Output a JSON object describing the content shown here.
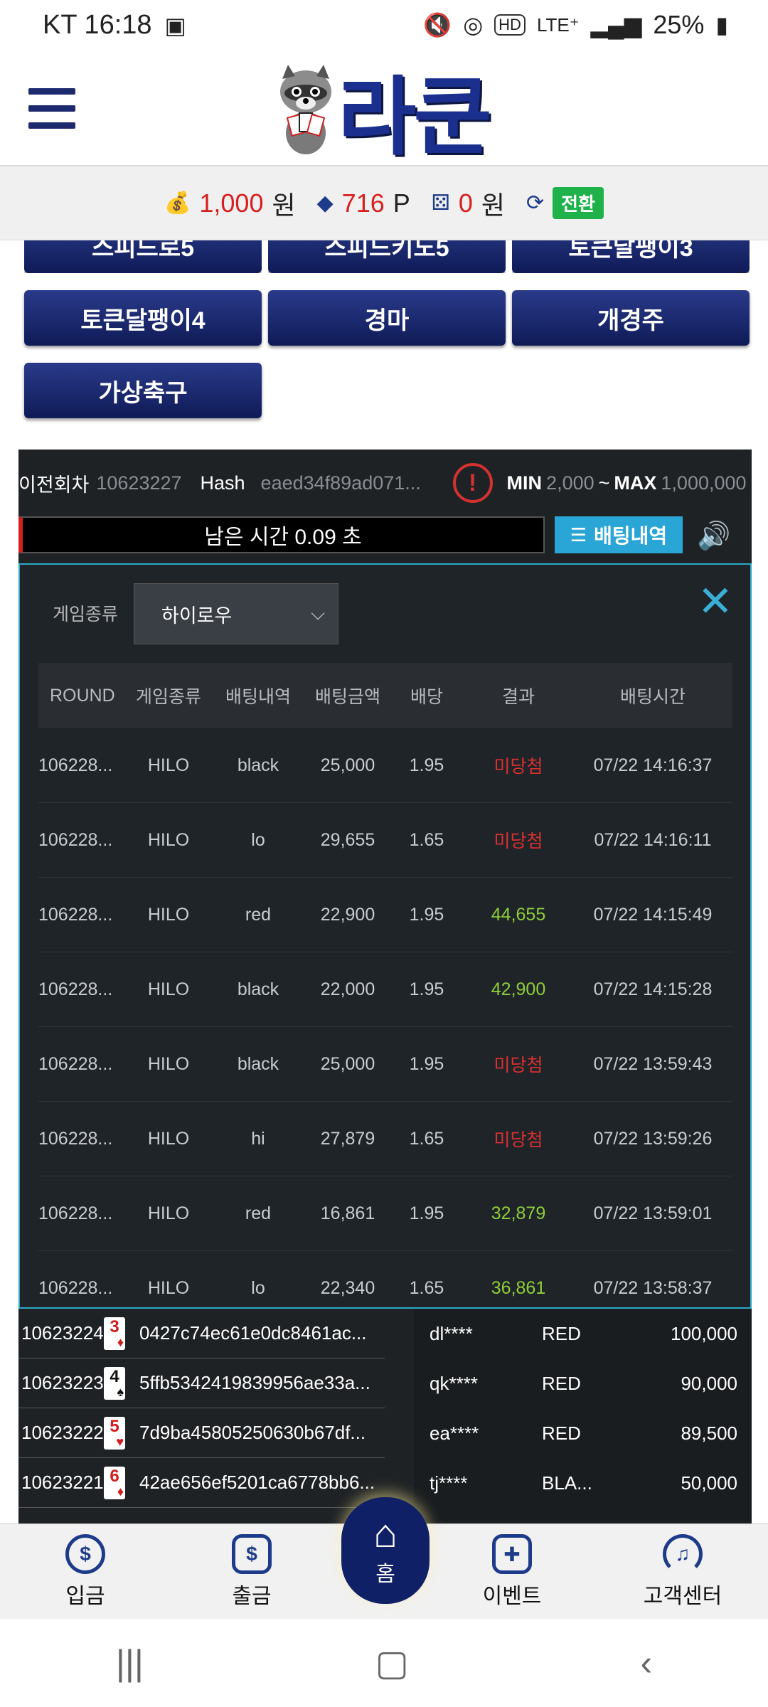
{
  "status_bar": {
    "carrier_time": "KT 16:18",
    "network": "LTE⁺",
    "battery": "25%"
  },
  "header": {
    "logo_text": "라쿤"
  },
  "balance": {
    "cash_value": "1,000",
    "cash_unit": "원",
    "points_value": "716",
    "points_unit": "P",
    "chips_value": "0",
    "chips_unit": "원",
    "swap_label": "전환"
  },
  "games": {
    "row0": [
      "스피드로5",
      "스피드키노5",
      "토큰달팽이3"
    ],
    "row1": [
      "토큰달팽이4",
      "경마",
      "개경주"
    ],
    "row2": [
      "가상축구"
    ]
  },
  "game_info": {
    "prev_round_label": "이전회차",
    "prev_round_value": "10623227",
    "hash_label": "Hash",
    "hash_value": "eaed34f89ad071...",
    "min_label": "MIN",
    "min_value": "2,000",
    "tilde": "~",
    "max_label": "MAX",
    "max_value": "1,000,000",
    "timer_text": "남은 시간 0.09 초",
    "history_button": "배팅내역"
  },
  "history_modal": {
    "filter_label": "게임종류",
    "filter_value": "하이로우",
    "columns": [
      "ROUND",
      "게임종류",
      "배팅내역",
      "배팅금액",
      "배당",
      "결과",
      "배팅시간"
    ],
    "rows": [
      {
        "round": "106228...",
        "game": "HILO",
        "bet": "black",
        "amount": "25,000",
        "odds": "1.95",
        "result": "미당첨",
        "time": "07/22 14:16:37"
      },
      {
        "round": "106228...",
        "game": "HILO",
        "bet": "lo",
        "amount": "29,655",
        "odds": "1.65",
        "result": "미당첨",
        "time": "07/22 14:16:11"
      },
      {
        "round": "106228...",
        "game": "HILO",
        "bet": "red",
        "amount": "22,900",
        "odds": "1.95",
        "result": "44,655",
        "time": "07/22 14:15:49"
      },
      {
        "round": "106228...",
        "game": "HILO",
        "bet": "black",
        "amount": "22,000",
        "odds": "1.95",
        "result": "42,900",
        "time": "07/22 14:15:28"
      },
      {
        "round": "106228...",
        "game": "HILO",
        "bet": "black",
        "amount": "25,000",
        "odds": "1.95",
        "result": "미당첨",
        "time": "07/22 13:59:43"
      },
      {
        "round": "106228...",
        "game": "HILO",
        "bet": "hi",
        "amount": "27,879",
        "odds": "1.65",
        "result": "미당첨",
        "time": "07/22 13:59:26"
      },
      {
        "round": "106228...",
        "game": "HILO",
        "bet": "red",
        "amount": "16,861",
        "odds": "1.95",
        "result": "32,879",
        "time": "07/22 13:59:01"
      },
      {
        "round": "106228...",
        "game": "HILO",
        "bet": "lo",
        "amount": "22,340",
        "odds": "1.65",
        "result": "36,861",
        "time": "07/22 13:58:37"
      }
    ]
  },
  "results_list": [
    {
      "round": "10623224",
      "card": "3",
      "suit": "♦",
      "color": "red",
      "hash": "0427c74ec61e0dc8461ac..."
    },
    {
      "round": "10623223",
      "card": "4",
      "suit": "♠",
      "color": "black",
      "hash": "5ffb5342419839956ae33a..."
    },
    {
      "round": "10623222",
      "card": "5",
      "suit": "♥",
      "color": "red",
      "hash": "7d9ba45805250630b67df..."
    },
    {
      "round": "10623221",
      "card": "6",
      "suit": "♦",
      "color": "red",
      "hash": "42ae656ef5201ca6778bb6..."
    }
  ],
  "live_bets": [
    {
      "user": "dl****",
      "pick": "RED",
      "amount": "100,000"
    },
    {
      "user": "qk****",
      "pick": "RED",
      "amount": "90,000"
    },
    {
      "user": "ea****",
      "pick": "RED",
      "amount": "89,500"
    },
    {
      "user": "tj****",
      "pick": "BLA...",
      "amount": "50,000"
    }
  ],
  "bottom_nav": {
    "deposit": "입금",
    "withdraw": "출금",
    "home": "홈",
    "event": "이벤트",
    "support": "고객센터"
  },
  "colors": {
    "brand_navy": "#1b2f8f",
    "lose_red": "#d83030",
    "win_green": "#8fcf3a",
    "accent_cyan": "#2aa6d6"
  }
}
